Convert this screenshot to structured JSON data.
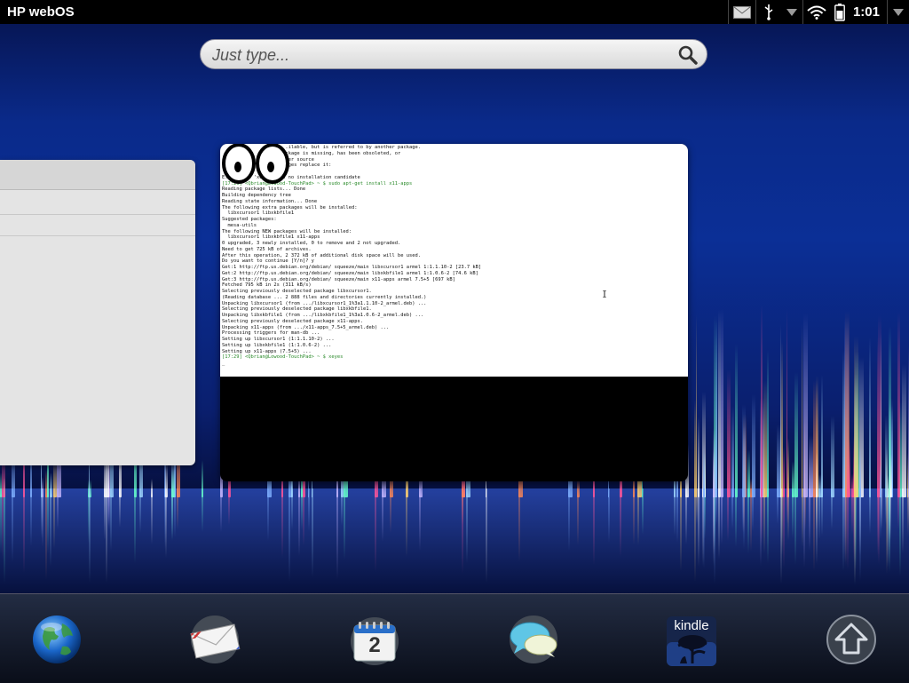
{
  "statusbar": {
    "title": "HP webOS",
    "clock": "1:01",
    "icons": [
      "mail-icon",
      "usb-icon",
      "menu-down-icon",
      "wifi-icon",
      "battery-icon",
      "menu-down-icon"
    ]
  },
  "search": {
    "placeholder": "Just type...",
    "icon": "search-icon"
  },
  "cards": {
    "left": {
      "app": "unknown"
    },
    "terminal": {
      "lines": [
        "                      .ilable, but is referred to by another package.",
        "                    package is missing, has been obsoleted, or",
        "                    other source",
        "                    Ikages replace it:",
        "",
        "E: Package 'xeyes' has no installation candidate",
        "[17:29] <Qbrian@Lowood-TouchPad> ~ $ sudo apt-get install x11-apps",
        "Reading package lists... Done",
        "Building dependency tree",
        "Reading state information... Done",
        "The following extra packages will be installed:",
        "  libxcursor1 libxkbfile1",
        "Suggested packages:",
        "  mesa-utils",
        "The following NEW packages will be installed:",
        "  libxcursor1 libxkbfile1 x11-apps",
        "0 upgraded, 3 newly installed, 0 to remove and 2 not upgraded.",
        "Need to get 725 kB of archives.",
        "After this operation, 2 372 kB of additional disk space will be used.",
        "Do you want to continue [Y/n]? y",
        "Get:1 http://ftp.us.debian.org/debian/ squeeze/main libxcursor1 armel 1:1.1.10-2 [23.7 kB]",
        "Get:2 http://ftp.us.debian.org/debian/ squeeze/main libxkbfile1 armel 1:1.0.6-2 [74.6 kB]",
        "Get:3 http://ftp.us.debian.org/debian/ squeeze/main x11-apps armel 7.5+5 [697 kB]",
        "Fetched 795 kB in 2s (311 kB/s)",
        "Selecting previously deselected package libxcursor1.",
        "(Reading database ... 2 888 files and directories currently installed.)",
        "Unpacking libxcursor1 (from .../libxcursor1_1%3a1.1.10-2_armel.deb) ...",
        "Selecting previously deselected package libxkbfile1.",
        "Unpacking libxkbfile1 (from .../libxkbfile1_1%3a1.0.6-2_armel.deb) ...",
        "Selecting previously deselected package x11-apps.",
        "Unpacking x11-apps (from .../x11-apps_7.5+5_armel.deb) ...",
        "Processing triggers for man-db ...",
        "Setting up libxcursor1 (1:1.1.10-2) ...",
        "Setting up libxkbfile1 (1:1.0.6-2) ...",
        "Setting up x11-apps (7.5+5) ...",
        "[17:29] <Qbrian@Lowood-TouchPad> ~ $ xeyes",
        "_"
      ]
    }
  },
  "dock": {
    "apps": [
      {
        "name": "web-browser",
        "icon": "globe-icon"
      },
      {
        "name": "email",
        "icon": "mail-envelope-icon"
      },
      {
        "name": "calendar",
        "icon": "calendar-icon",
        "label": "2"
      },
      {
        "name": "messaging",
        "icon": "chat-bubbles-icon"
      },
      {
        "name": "kindle",
        "icon": "kindle-icon",
        "label": "kindle"
      },
      {
        "name": "launcher",
        "icon": "launcher-up-arrow-icon"
      }
    ]
  },
  "colors": {
    "statusbar": "#000000",
    "terminal_bg": "#ffffff",
    "prompt_green": "#2a8a2a",
    "prompt_magenta": "#b02cb0"
  }
}
